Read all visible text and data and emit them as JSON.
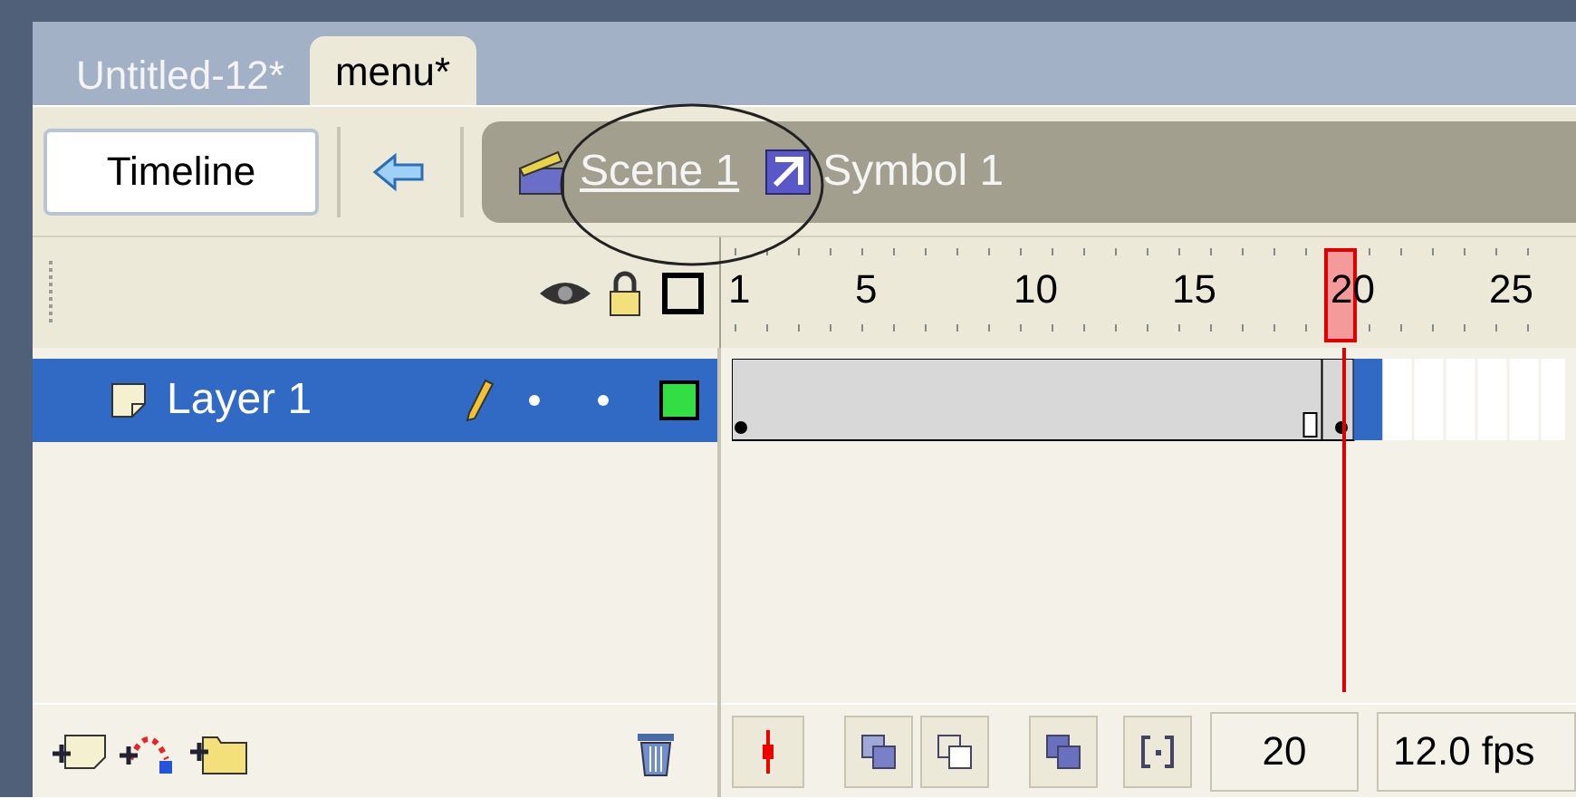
{
  "document_tabs": [
    {
      "label": "Untitled-12*",
      "selected": false
    },
    {
      "label": "menu*",
      "selected": true
    }
  ],
  "toolbar": {
    "timeline_button": "Timeline",
    "breadcrumbs": [
      {
        "kind": "scene",
        "label": "Scene 1"
      },
      {
        "kind": "symbol",
        "label": "Symbol 1"
      }
    ]
  },
  "ruler": {
    "labels": [
      "1",
      "5",
      "10",
      "15",
      "20",
      "25"
    ]
  },
  "layers": [
    {
      "name": "Layer 1",
      "selected": true
    }
  ],
  "status": {
    "current_frame": "20",
    "frame_rate": "12.0 fps"
  }
}
